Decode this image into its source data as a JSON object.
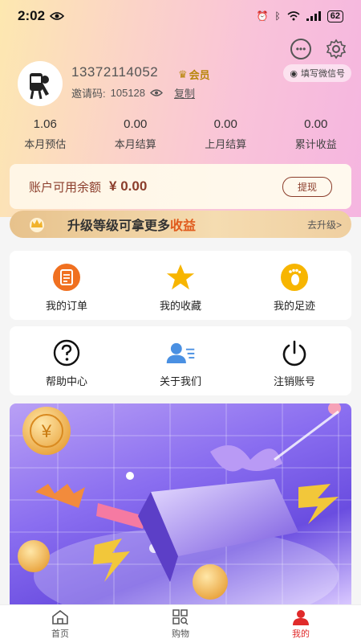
{
  "status_bar": {
    "time": "2:02",
    "battery": "62"
  },
  "header": {
    "wechat_pill": "填写微信号",
    "phone": "13372114052",
    "vip_label": "会员",
    "invite_label": "邀请码:",
    "invite_code": "105128",
    "copy_label": "复制"
  },
  "stats": [
    {
      "value": "1.06",
      "label": "本月预估"
    },
    {
      "value": "0.00",
      "label": "本月结算"
    },
    {
      "value": "0.00",
      "label": "上月结算"
    },
    {
      "value": "0.00",
      "label": "累计收益"
    }
  ],
  "balance": {
    "label": "账户可用余额",
    "value": "¥ 0.00",
    "withdraw_label": "提现"
  },
  "upgrade": {
    "text_a": "升级等级可拿更多",
    "text_b": "收益",
    "link": "去升级>"
  },
  "menu_row_1": [
    {
      "label": "我的订单",
      "icon": "order-icon"
    },
    {
      "label": "我的收藏",
      "icon": "star-icon"
    },
    {
      "label": "我的足迹",
      "icon": "footprint-icon"
    }
  ],
  "menu_row_2": [
    {
      "label": "帮助中心",
      "icon": "help-icon"
    },
    {
      "label": "关于我们",
      "icon": "about-icon"
    },
    {
      "label": "注销账号",
      "icon": "power-icon"
    }
  ],
  "tabbar": [
    {
      "label": "首页",
      "icon": "home-icon"
    },
    {
      "label": "购物",
      "icon": "grid-search-icon"
    },
    {
      "label": "我的",
      "icon": "user-icon",
      "active": true
    }
  ],
  "colors": {
    "accent": "#e02a2a",
    "brown": "#8b3d2b",
    "orange": "#f07020",
    "star": "#f7b500"
  }
}
